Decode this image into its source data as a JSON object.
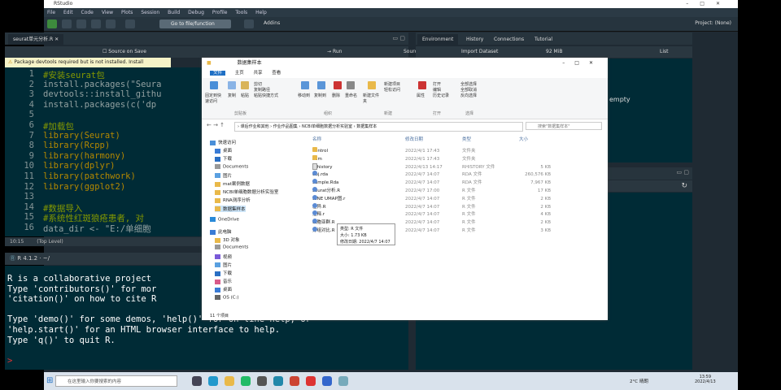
{
  "rstudio": {
    "title": "RStudio",
    "menu": [
      "File",
      "Edit",
      "Code",
      "View",
      "Plots",
      "Session",
      "Build",
      "Debug",
      "Profile",
      "Tools",
      "Help"
    ],
    "goto_placeholder": "Go to file/function",
    "addins": "Addins",
    "project": "Project: (None)",
    "editor_tab": "seurat单元分析.R",
    "source_on_save": "Source on Save",
    "run": "Run",
    "source": "Source",
    "warning": "Package devtools required but is not installed. Install",
    "lines": [
      {
        "n": "1",
        "t": "#安装seurat包",
        "k": "cm"
      },
      {
        "n": "2",
        "t": "install.packages(\"Seura",
        "k": "tx"
      },
      {
        "n": "3",
        "t": "devtools::install_githu",
        "k": "tx"
      },
      {
        "n": "4",
        "t": "install.packages(c('dp",
        "k": "tx"
      },
      {
        "n": "5",
        "t": "",
        "k": "tx"
      },
      {
        "n": "6",
        "t": "#加载包",
        "k": "cm"
      },
      {
        "n": "7",
        "t": "library(Seurat)",
        "k": "fn"
      },
      {
        "n": "8",
        "t": "library(Rcpp)",
        "k": "fn"
      },
      {
        "n": "9",
        "t": "library(harmony)",
        "k": "fn"
      },
      {
        "n": "10",
        "t": "library(dplyr)",
        "k": "fn"
      },
      {
        "n": "11",
        "t": "library(patchwork)",
        "k": "fn"
      },
      {
        "n": "12",
        "t": "library(ggplot2)",
        "k": "fn"
      },
      {
        "n": "13",
        "t": "",
        "k": "tx"
      },
      {
        "n": "14",
        "t": "#数据导入",
        "k": "cm"
      },
      {
        "n": "15",
        "t": "#系统性红斑狼疮患者, 对",
        "k": "cm"
      },
      {
        "n": "16",
        "t": "data_dir <- \"E:/单细胞",
        "k": "tx"
      }
    ],
    "cursor_pos": "10:15",
    "scope": "(Top Level)",
    "console_title": "R 4.1.2 · ~/",
    "console_lines": [
      "R is a collaborative project",
      "Type 'contributors()' for mor",
      "'citation()' on how to cite R",
      "",
      "Type 'demo()' for some demos, 'help()' for on-line help, or",
      "'help.start()' for an HTML browser interface to help.",
      "Type 'q()' to quit R.",
      "",
      ">"
    ],
    "env_tabs": [
      "Environment",
      "History",
      "Connections",
      "Tutorial"
    ],
    "import_dataset": "Import Dataset",
    "memory": "92 MiB",
    "list_view": "List",
    "env_empty": "empty"
  },
  "explorer": {
    "title": "数据集样本",
    "ribbon_tabs": [
      "文件",
      "主页",
      "共享",
      "查看"
    ],
    "ribbon_labels": [
      "固定到快速访问",
      "复制",
      "粘贴",
      "剪切",
      "复制路径",
      "粘贴快捷方式",
      "移动到",
      "复制到",
      "删除",
      "重命名",
      "新建文件夹",
      "新建项目",
      "轻松访问",
      "属性",
      "打开",
      "编辑",
      "历史记录",
      "全部选择",
      "全部取消",
      "反向选择"
    ],
    "ribbon_groups": [
      "剪贴板",
      "组织",
      "新建",
      "打开",
      "选择"
    ],
    "path": "› 课后作业和其他 › 作业作品图集 › NCBI单细胞数据分析实验室 › 数据集样本",
    "search_placeholder": "搜索\"数据集样本\"",
    "nav": [
      {
        "label": "快速访问",
        "type": "star"
      },
      {
        "label": "桌面",
        "type": "desk"
      },
      {
        "label": "下载",
        "type": "down"
      },
      {
        "label": "Documents",
        "type": "doc"
      },
      {
        "label": "图片",
        "type": "pic"
      },
      {
        "label": "mat案例数据",
        "type": "folder"
      },
      {
        "label": "NCBI单细胞数据分析实验室",
        "type": "folder"
      },
      {
        "label": "RNA测序分析",
        "type": "folder"
      },
      {
        "label": "数据集样本",
        "type": "folder"
      },
      {
        "label": "OneDrive",
        "type": "cloud"
      },
      {
        "label": "此电脑",
        "type": "pc"
      },
      {
        "label": "3D 对象",
        "type": "folder"
      },
      {
        "label": "Documents",
        "type": "doc"
      },
      {
        "label": "视频",
        "type": "vid"
      },
      {
        "label": "图片",
        "type": "pic"
      },
      {
        "label": "下载",
        "type": "down"
      },
      {
        "label": "音乐",
        "type": "music"
      },
      {
        "label": "桌面",
        "type": "desk"
      },
      {
        "label": "OS (C:)",
        "type": "drive"
      }
    ],
    "columns": [
      "名称",
      "修改日期",
      "类型",
      "大小"
    ],
    "files": [
      {
        "name": "control",
        "date": "2022/4/1 17:43",
        "type": "文件夹",
        "size": "",
        "icon": "folder"
      },
      {
        "name": "stim",
        "date": "2022/4/1 17:43",
        "type": "文件夹",
        "size": "",
        "icon": "folder"
      },
      {
        "name": ".Rhistory",
        "date": "2022/4/13 14:17",
        "type": "RHISTORY 文件",
        "size": "5 KB",
        "icon": "doc"
      },
      {
        "name": "obj.rda",
        "date": "2022/4/7 14:07",
        "type": "RDA 文件",
        "size": "260,576 KB",
        "icon": "r"
      },
      {
        "name": "sample.Rda",
        "date": "2022/4/7 14:07",
        "type": "RDA 文件",
        "size": "7,967 KB",
        "icon": "r"
      },
      {
        "name": "seurat分析.R",
        "date": "2022/4/7 17:00",
        "type": "R 文件",
        "size": "17 KB",
        "icon": "r"
      },
      {
        "name": "tSNE UMAP图.r",
        "date": "2022/4/7 14:07",
        "type": "R 文件",
        "size": "2 KB",
        "icon": "r"
      },
      {
        "name": "差异.R",
        "date": "2022/4/7 14:07",
        "type": "R 文件",
        "size": "2 KB",
        "icon": "r"
      },
      {
        "name": "注释.r",
        "date": "2022/4/7 14:07",
        "type": "R 文件",
        "size": "4 KB",
        "icon": "r"
      },
      {
        "name": "细胞亚群.R",
        "date": "2022/4/7 14:07",
        "type": "R 文件",
        "size": "2 KB",
        "icon": "r"
      },
      {
        "name": "分组对比.R",
        "date": "2022/4/7 14:07",
        "type": "R 文件",
        "size": "3 KB",
        "icon": "r"
      }
    ],
    "tooltip": [
      "类型: R 文件",
      "大小: 1.73 KB",
      "修改日期: 2022/4/7 14:07"
    ],
    "status": "11 个项目"
  },
  "taskbar": {
    "search_placeholder": "在这里输入你要搜索的内容",
    "weather": "2°C 晴朗",
    "time": "13:59",
    "date": "2022/4/13"
  }
}
